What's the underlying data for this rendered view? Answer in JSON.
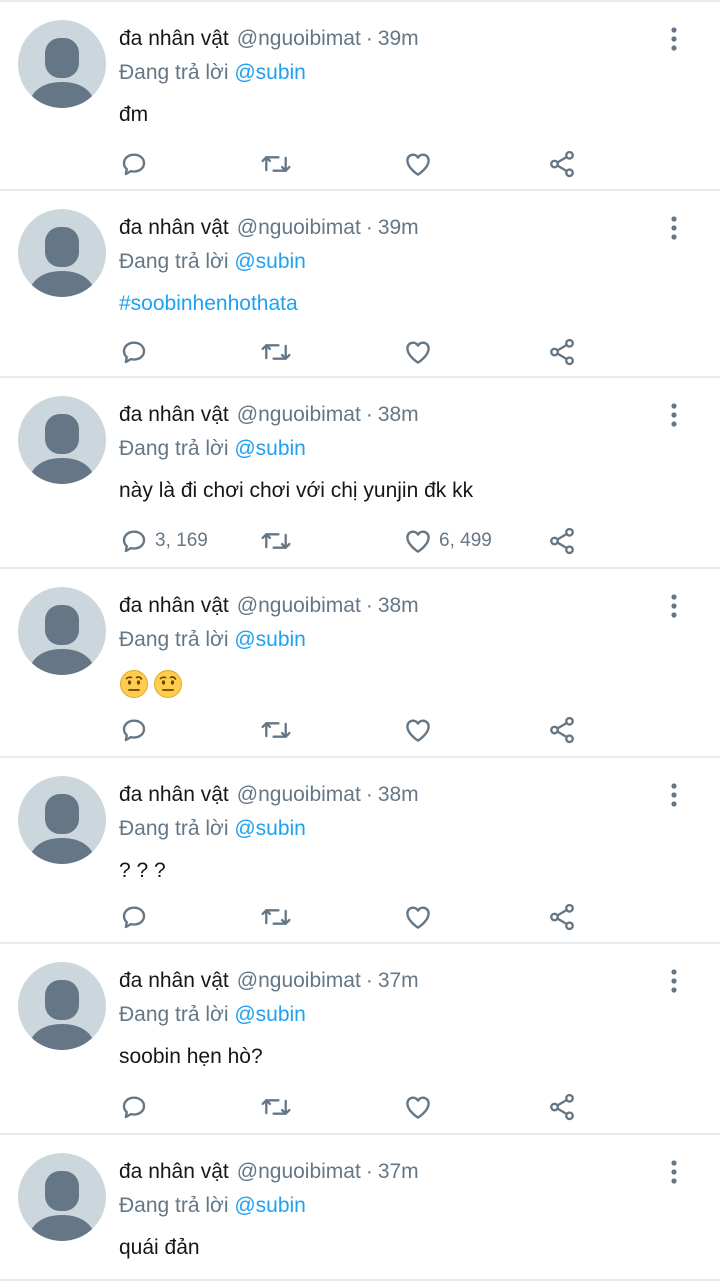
{
  "colors": {
    "accent": "#1da1f2",
    "muted": "#657786",
    "divider": "#e6ecf0",
    "avatar_bg": "#ccd6dd",
    "avatar_fg": "#657786"
  },
  "icons": {
    "reply": "reply-icon",
    "retweet": "retweet-icon",
    "like": "heart-icon",
    "share": "share-icon",
    "more": "more-vertical-icon"
  },
  "tweets": [
    {
      "name": "đa nhân vật",
      "handle": "@nguoibimat",
      "sep": "·",
      "time": "39m",
      "reply_prefix": "Đang trả lời",
      "reply_to": "@subin",
      "text": "đm",
      "text_kind": "plain",
      "reply_count": "",
      "like_count": ""
    },
    {
      "name": "đa nhân vật",
      "handle": "@nguoibimat",
      "sep": "·",
      "time": "39m",
      "reply_prefix": "Đang trả lời",
      "reply_to": "@subin",
      "text": "#soobinhenhothata",
      "text_kind": "hashtag",
      "reply_count": "",
      "like_count": ""
    },
    {
      "name": "đa nhân vật",
      "handle": "@nguoibimat",
      "sep": "·",
      "time": "38m",
      "reply_prefix": "Đang trả lời",
      "reply_to": "@subin",
      "text": "này là đi chơi chơi với chị yunjin đk kk",
      "text_kind": "plain",
      "reply_count": "3, 169",
      "like_count": "6, 499"
    },
    {
      "name": "đa nhân vật",
      "handle": "@nguoibimat",
      "sep": "·",
      "time": "38m",
      "reply_prefix": "Đang trả lời",
      "reply_to": "@subin",
      "text": "",
      "text_kind": "emoji",
      "emojis": [
        "face-with-raised-eyebrow-emoji",
        "face-with-raised-eyebrow-emoji"
      ],
      "reply_count": "",
      "like_count": ""
    },
    {
      "name": "đa nhân vật",
      "handle": "@nguoibimat",
      "sep": "·",
      "time": "38m",
      "reply_prefix": "Đang trả lời",
      "reply_to": "@subin",
      "text": "? ? ?",
      "text_kind": "plain",
      "reply_count": "",
      "like_count": ""
    },
    {
      "name": "đa nhân vật",
      "handle": "@nguoibimat",
      "sep": "·",
      "time": "37m",
      "reply_prefix": "Đang trả lời",
      "reply_to": "@subin",
      "text": "soobin hẹn hò?",
      "text_kind": "plain",
      "reply_count": "",
      "like_count": ""
    },
    {
      "name": "đa nhân vật",
      "handle": "@nguoibimat",
      "sep": "·",
      "time": "37m",
      "reply_prefix": "Đang trả lời",
      "reply_to": "@subin",
      "text": "quái đản",
      "text_kind": "plain",
      "reply_count": "",
      "like_count": ""
    }
  ]
}
